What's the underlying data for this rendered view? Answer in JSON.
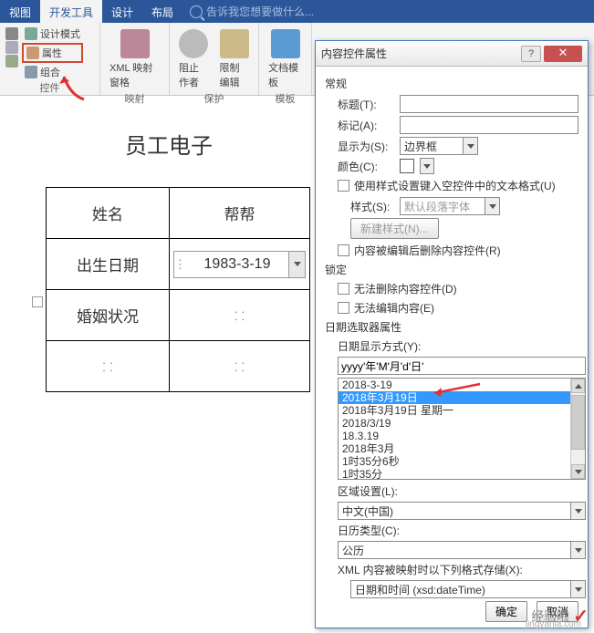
{
  "ribbon": {
    "tabs": [
      "视图",
      "开发工具",
      "设计",
      "布局"
    ],
    "active_tab": "开发工具",
    "tell_me": "告诉我您想要做什么...",
    "groups": {
      "controls": {
        "design_mode": "设计模式",
        "properties": "属性",
        "group": "组合",
        "label": "控件"
      },
      "mapping": {
        "xml_pane": "XML 映射窗格",
        "label": "映射"
      },
      "protect": {
        "block_authors": "阻止作者",
        "restrict_edit": "限制编辑",
        "label": "保护"
      },
      "templates": {
        "doc_template": "文档模板",
        "label": "模板"
      }
    }
  },
  "doc": {
    "title": "员工电子",
    "rows": {
      "name_label": "姓名",
      "name_value": "帮帮",
      "dob_label": "出生日期",
      "dob_value": "1983-3-19",
      "marital_label": "婚姻状况",
      "marital_value": "",
      "r4c1": "",
      "r4c2": ""
    }
  },
  "dialog": {
    "title": "内容控件属性",
    "sections": {
      "general": "常规",
      "lock": "锁定",
      "datepicker": "日期选取器属性"
    },
    "labels": {
      "title_l": "标题(T):",
      "tag_l": "标记(A):",
      "show_as_l": "显示为(S):",
      "color_l": "颜色(C):",
      "style_l": "样式(S):",
      "format_l": "日期显示方式(Y):",
      "locale_l": "区域设置(L):",
      "calendar_l": "日历类型(C):",
      "xml_l": "XML 内容被映射时以下列格式存储(X):"
    },
    "values": {
      "title_v": "",
      "tag_v": "",
      "show_as_v": "边界框",
      "style_v": "默认段落字体",
      "format_v": "yyyy'年'M'月'd'日'",
      "locale_v": "中文(中国)",
      "calendar_v": "公历",
      "xml_v": "日期和时间 (xsd:dateTime)"
    },
    "checkboxes": {
      "use_style": "使用样式设置键入空控件中的文本格式(U)",
      "remove_after": "内容被编辑后删除内容控件(R)",
      "no_delete": "无法删除内容控件(D)",
      "no_edit": "无法编辑内容(E)"
    },
    "buttons": {
      "new_style": "新建样式(N)...",
      "ok": "确定",
      "cancel": "取消"
    },
    "format_list": [
      "2018-3-19",
      "2018年3月19日",
      "2018年3月19日 星期一",
      "2018/3/19",
      "18.3.19",
      "2018年3月",
      "1时35分6秒",
      "1时35分"
    ],
    "format_selected_index": 1
  },
  "watermark": {
    "text": "经验啦",
    "sub": "jingyanla.com"
  }
}
